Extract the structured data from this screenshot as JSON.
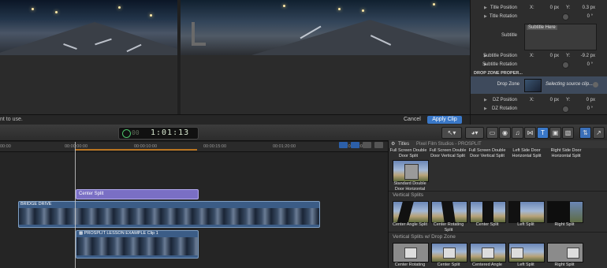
{
  "inspector": {
    "rows": [
      {
        "label": "Title Position",
        "x_label": "X:",
        "x_value": "0 px",
        "y_label": "Y:",
        "y_value": "0.3 px"
      },
      {
        "label": "Title Rotation",
        "degrees": "0 °"
      },
      {
        "label": "Subtitle",
        "text": "Subtitle Here"
      },
      {
        "label": "Subtitle Position",
        "x_label": "X:",
        "x_value": "0 px",
        "y_label": "Y:",
        "y_value": "-9.2 px"
      },
      {
        "label": "Subtitle Rotation",
        "degrees": "0 °"
      },
      {
        "label": "Drop Zone",
        "status": "Selecting source clip..."
      },
      {
        "label": "DZ Position",
        "x_label": "X:",
        "x_value": "0 px",
        "y_label": "Y:",
        "y_value": "0 px"
      },
      {
        "label": "DZ Rotation",
        "degrees": "0 °"
      }
    ],
    "section": "DROP ZONE PROPER..."
  },
  "viewer_bar": {
    "hint": "nt to use.",
    "cancel": "Cancel",
    "apply": "Apply Clip"
  },
  "toolbar": {
    "timecode": "1:01:13",
    "timecode_prefix": "00"
  },
  "timeline": {
    "ruler_ticks": [
      "00:00",
      "00:00:00:00",
      "00:00:10:00",
      "00:00:15:00",
      "00:01:20:00",
      "00:01:00:00"
    ],
    "title_clip": "Center Split",
    "clips": [
      {
        "name": "BRIDGE DRIVE"
      },
      {
        "name": "PROSPLIT LESSON EXAMPLE Clip 1"
      }
    ]
  },
  "browser": {
    "header": "Titles",
    "header_path": "Pixel Film Studios - PROSPLIT",
    "top_row": [
      {
        "label": "Full Screen Double Door Split"
      },
      {
        "label": "Full Screen Double Door Vertical Split"
      },
      {
        "label": "Full Screen Double Door Vertical Split"
      },
      {
        "label": "Left Side Door Horizontal Split"
      },
      {
        "label": "Right Side Door Horizontal Split"
      }
    ],
    "standard": {
      "label": "Standard Double Door Horizontal"
    },
    "sections": [
      {
        "title": "Vertical Splits",
        "items": [
          {
            "label": "Center Angle Split"
          },
          {
            "label": "Center Rotating Split"
          },
          {
            "label": "Center Split"
          },
          {
            "label": "Left Split"
          },
          {
            "label": "Right Split"
          }
        ]
      },
      {
        "title": "Vertical Splits w/ Drop Zone",
        "items": [
          {
            "label": "Center Rotating"
          },
          {
            "label": "Center Split"
          },
          {
            "label": "Centered Angle"
          },
          {
            "label": "Left Split"
          },
          {
            "label": "Right Split"
          }
        ]
      }
    ]
  }
}
